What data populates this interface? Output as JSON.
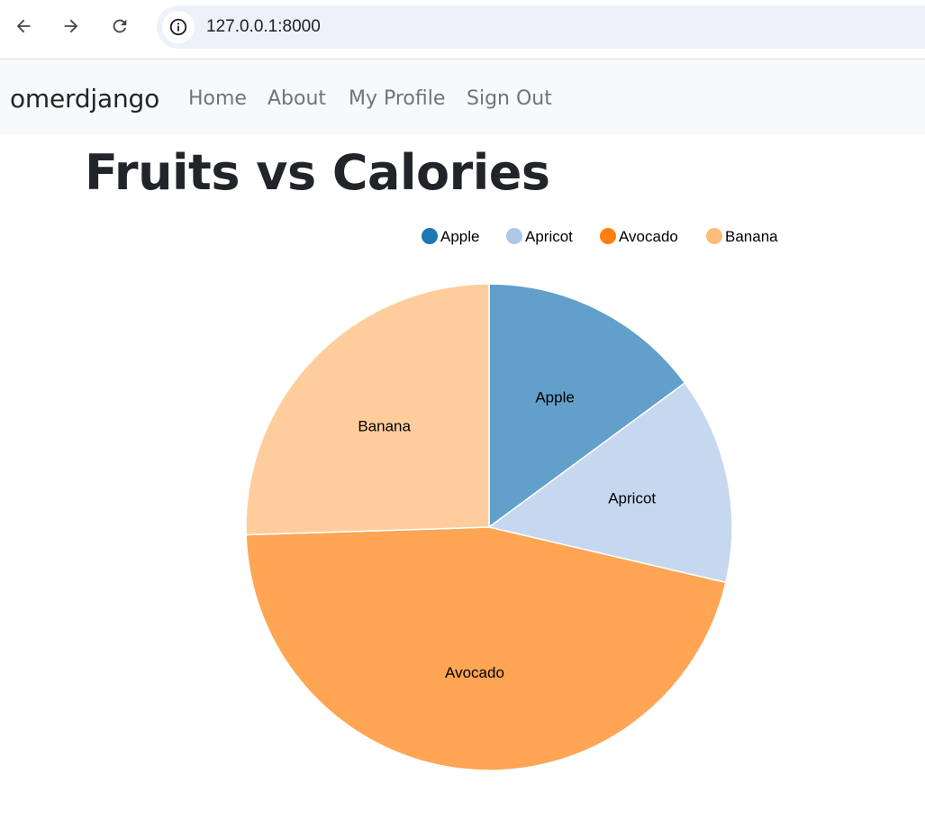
{
  "browser": {
    "url": "127.0.0.1:8000",
    "icons": [
      "back-arrow-icon",
      "forward-arrow-icon",
      "reload-icon",
      "info-icon"
    ]
  },
  "site_nav": {
    "brand": "omerdjango",
    "links": [
      "Home",
      "About",
      "My Profile",
      "Sign Out"
    ]
  },
  "page": {
    "title": "Fruits vs Calories"
  },
  "chart_data": {
    "type": "pie",
    "title": "",
    "legend_position": "top-right",
    "categories": [
      "Apple",
      "Apricot",
      "Avocado",
      "Banana"
    ],
    "values": [
      52,
      48,
      160,
      89
    ],
    "legend_colors": [
      "#1f77b4",
      "#aec7e8",
      "#ff7f0e",
      "#ffbb78"
    ],
    "slice_colors": [
      "#62a0cb",
      "#c6d8ef",
      "#ffa553",
      "#ffcd9c"
    ]
  }
}
